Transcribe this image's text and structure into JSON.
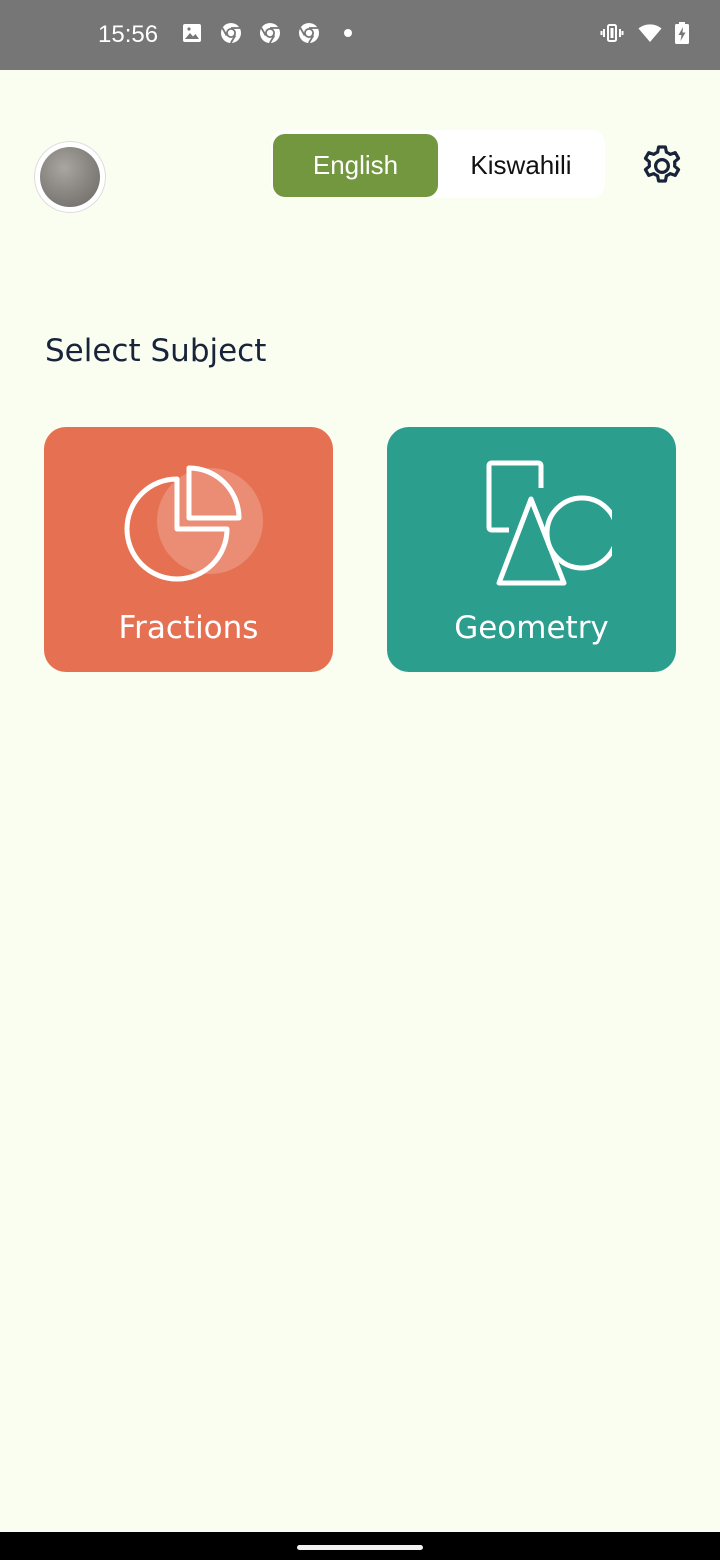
{
  "status_bar": {
    "time": "15:56",
    "notification_icons": [
      "image-icon",
      "chrome-icon",
      "chrome-icon",
      "chrome-icon",
      "dot-icon"
    ],
    "system_icons": [
      "vibrate-icon",
      "wifi-icon",
      "battery-charging-icon"
    ]
  },
  "header": {
    "avatar_icon": "profile-avatar",
    "language": {
      "selected": "English",
      "options": [
        "English",
        "Kiswahili"
      ]
    },
    "settings_icon": "gear-icon"
  },
  "main": {
    "section_title": "Select Subject",
    "subjects": [
      {
        "label": "Fractions",
        "icon": "pie-chart-icon",
        "color": "#E67052"
      },
      {
        "label": "Geometry",
        "icon": "shapes-icon",
        "color": "#2B9E8E"
      }
    ]
  },
  "colors": {
    "background": "#FAFEF1",
    "accent": "#72973E",
    "title": "#19243A"
  }
}
